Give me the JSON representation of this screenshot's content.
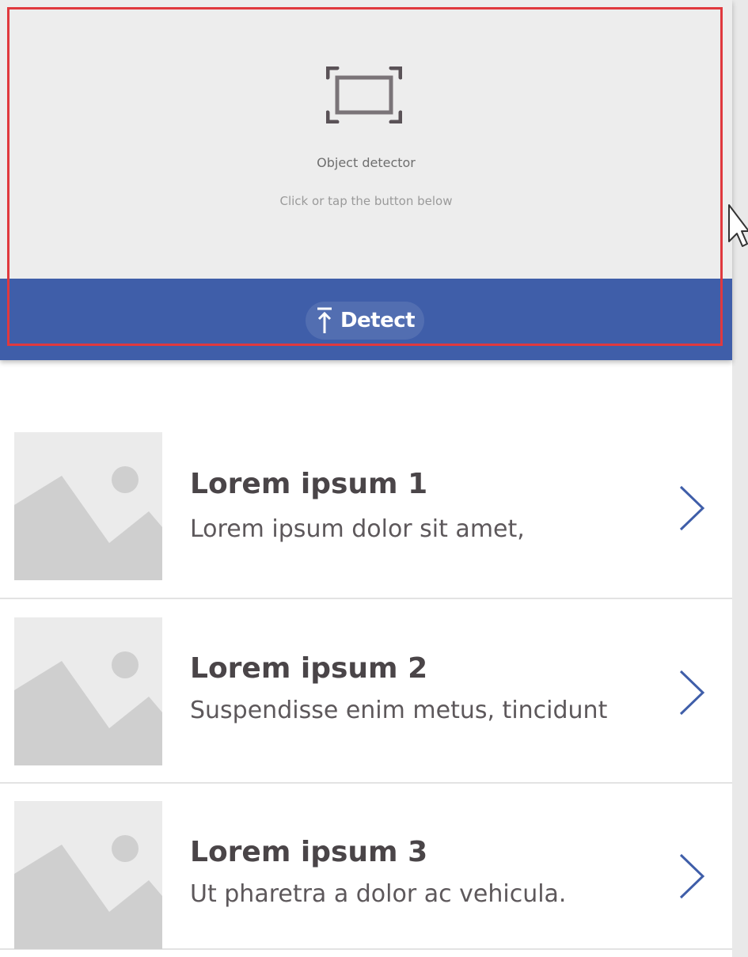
{
  "detector": {
    "title": "Object detector",
    "subtitle": "Click or tap the button below",
    "button_label": "Detect",
    "icon": "scan-frame-icon",
    "button_icon": "upload-arrow-icon",
    "bar_color": "#3f5ea9",
    "highlight_color": "#e0393e"
  },
  "list": {
    "items": [
      {
        "title": "Lorem ipsum 1",
        "subtitle": "Lorem ipsum dolor sit amet,",
        "icon": "image-placeholder-icon"
      },
      {
        "title": "Lorem ipsum 2",
        "subtitle": "Suspendisse enim metus, tincidunt",
        "icon": "image-placeholder-icon"
      },
      {
        "title": "Lorem ipsum 3",
        "subtitle": "Ut pharetra a dolor ac vehicula.",
        "icon": "image-placeholder-icon"
      }
    ],
    "chevron_icon": "chevron-right-icon",
    "chevron_color": "#3f5ea9"
  }
}
